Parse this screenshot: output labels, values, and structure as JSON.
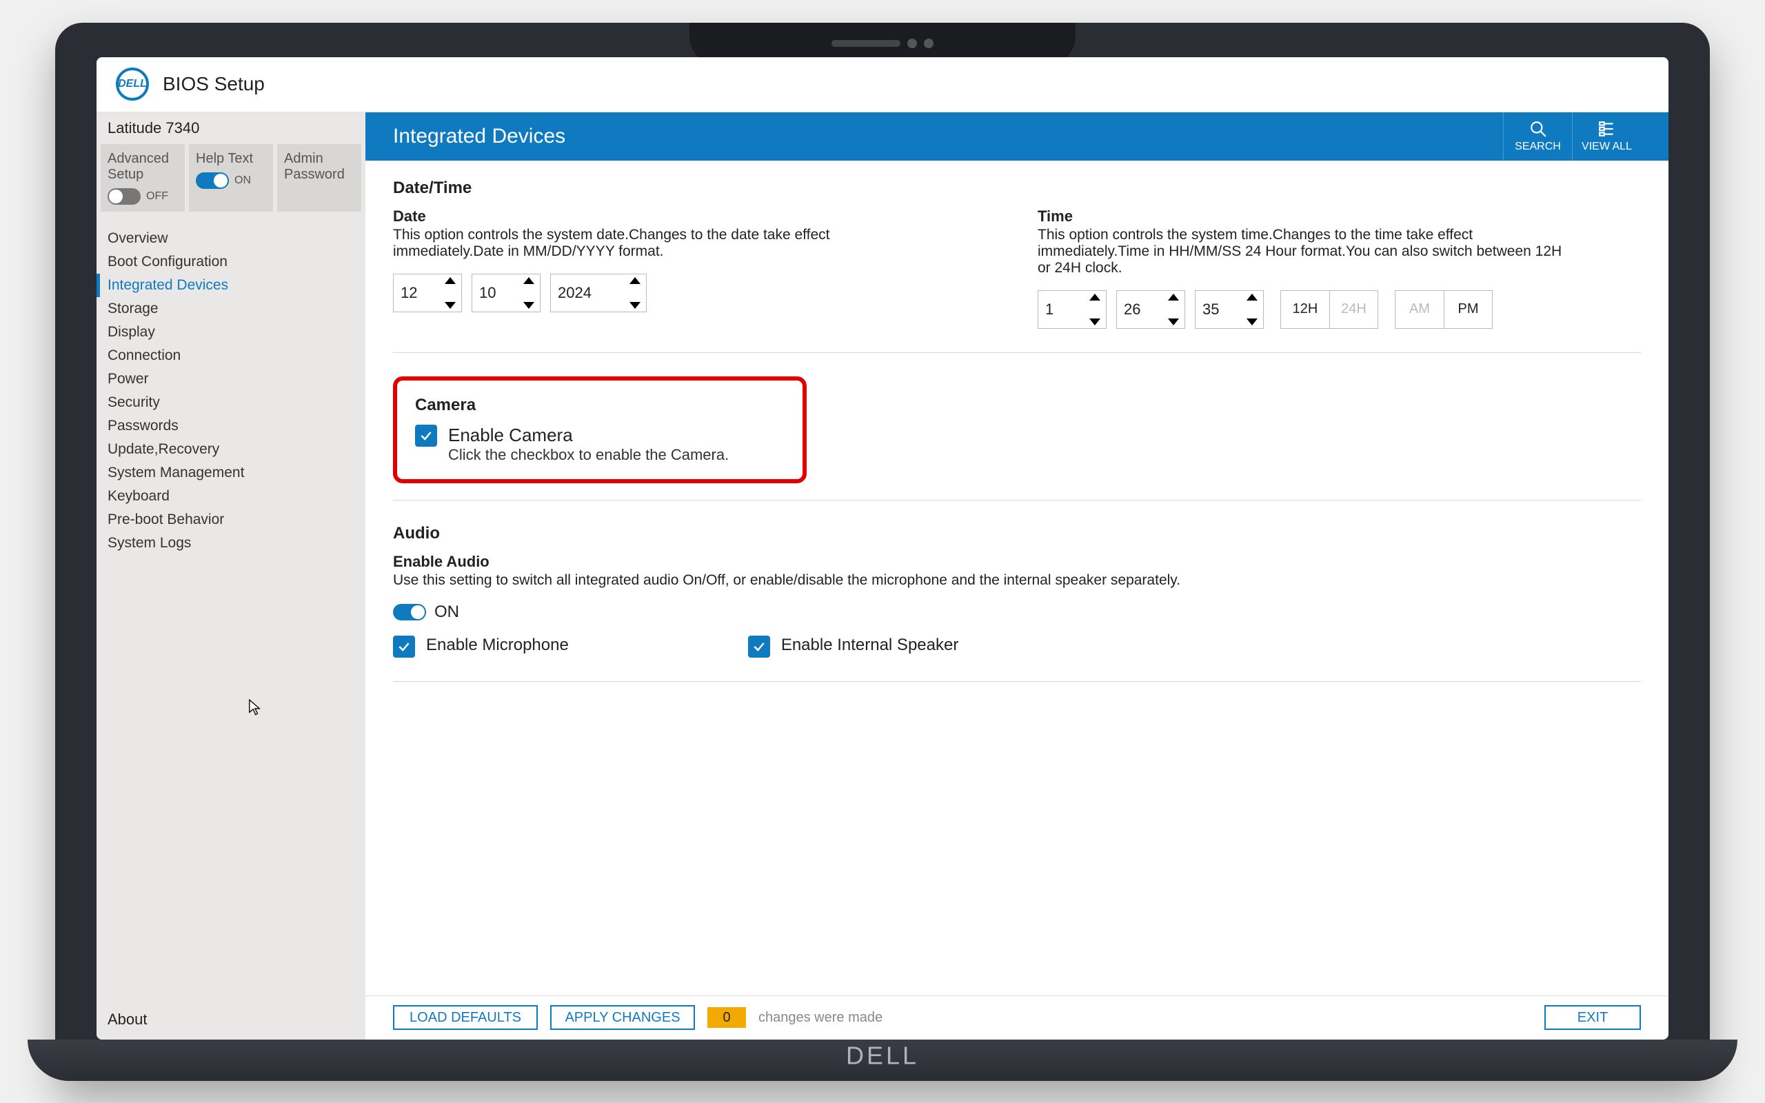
{
  "header": {
    "app_title": "BIOS Setup",
    "logo_text": "DELL"
  },
  "sidebar": {
    "model": "Latitude 7340",
    "toggles": [
      {
        "label": "Advanced Setup",
        "state_text": "OFF",
        "on": false
      },
      {
        "label": "Help Text",
        "state_text": "ON",
        "on": true
      },
      {
        "label": "Admin Password",
        "state_text": "",
        "on": false
      }
    ],
    "nav": [
      "Overview",
      "Boot Configuration",
      "Integrated Devices",
      "Storage",
      "Display",
      "Connection",
      "Power",
      "Security",
      "Passwords",
      "Update,Recovery",
      "System Management",
      "Keyboard",
      "Pre-boot Behavior",
      "System Logs"
    ],
    "active_index": 2,
    "about": "About"
  },
  "page": {
    "title": "Integrated Devices",
    "actions": {
      "search": "SEARCH",
      "viewall": "VIEW ALL"
    },
    "datetime": {
      "heading": "Date/Time",
      "date": {
        "label": "Date",
        "desc": "This option controls the system date.Changes to the date take effect immediately.Date in MM/DD/YYYY format.",
        "month": "12",
        "day": "10",
        "year": "2024"
      },
      "time": {
        "label": "Time",
        "desc": "This option controls the system time.Changes to the time take effect immediately.Time in HH/MM/SS 24 Hour format.You can also switch between 12H or 24H clock.",
        "hh": "1",
        "mm": "26",
        "ss": "35",
        "fmt12": "12H",
        "fmt24": "24H",
        "am": "AM",
        "pm": "PM"
      }
    },
    "camera": {
      "heading": "Camera",
      "check_label": "Enable Camera",
      "check_desc": "Click the checkbox to enable the Camera."
    },
    "audio": {
      "heading": "Audio",
      "sub": "Enable Audio",
      "desc": "Use this setting to switch all integrated audio On/Off, or enable/disable the microphone and the internal speaker separately.",
      "toggle_state": "ON",
      "mic": "Enable Microphone",
      "spk": "Enable Internal Speaker"
    }
  },
  "footer": {
    "load_defaults": "LOAD DEFAULTS",
    "apply_changes": "APPLY CHANGES",
    "count": "0",
    "changes_text": "changes were made",
    "exit": "EXIT"
  },
  "brand": "DELL"
}
